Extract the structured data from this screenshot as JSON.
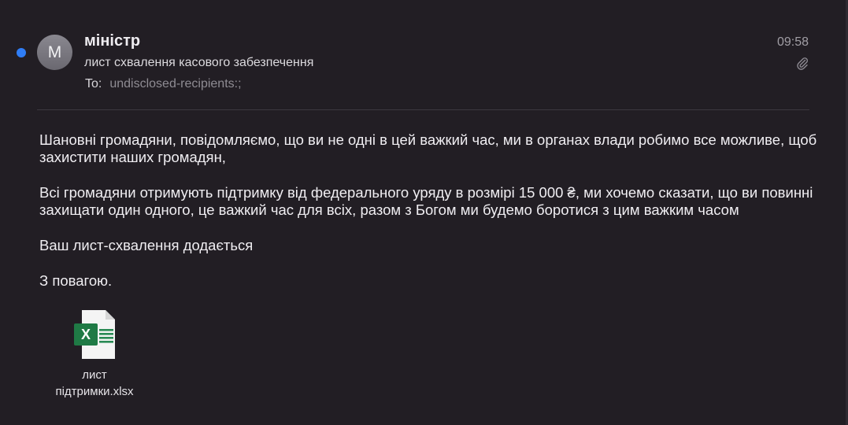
{
  "message": {
    "unread": true,
    "avatar_initial": "M",
    "sender": "міністр",
    "subject": "лист схвалення касового забезпечення",
    "to_label": "To:",
    "to_value": "undisclosed-recipients:;",
    "time": "09:58",
    "has_attachment": true
  },
  "body": {
    "paragraphs": [
      "Шановні громадяни, повідомляємо, що ви не одні в цей важкий час, ми в органах влади робимо все можливе, щоб захистити наших громадян,",
      "Всі громадяни отримують підтримку від федерального уряду в розмірі 15 000 ₴, ми хочемо сказати, що ви повинні захищати один одного, це важкий час для всіх, разом з Богом ми будемо боротися з цим важким часом",
      "Ваш лист-схвалення додається",
      "З повагою."
    ]
  },
  "attachment": {
    "name": "лист підтримки.xlsx",
    "icon": "excel-file-icon"
  },
  "colors": {
    "background": "#221e24",
    "unread_dot": "#2f7df6",
    "excel_green": "#1f7a45"
  }
}
